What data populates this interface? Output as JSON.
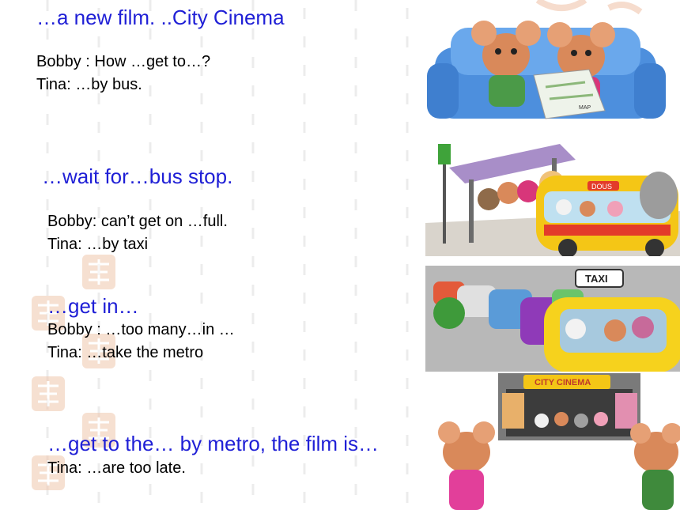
{
  "slide": {
    "scenes": [
      {
        "heading": "…a new film. ..City Cinema",
        "lines": [
          "Bobby : How …get to…?",
          "Tina:  …by bus."
        ]
      },
      {
        "heading": "…wait for…bus stop.",
        "lines": [
          "Bobby: can’t get on …full.",
          "Tina: …by taxi"
        ]
      },
      {
        "heading": "…get in…",
        "lines": [
          "Bobby : …too many…in …",
          "Tina: …take the metro"
        ]
      },
      {
        "heading": "…get to the… by metro, the film is…",
        "lines": [
          "Tina: …are too late."
        ]
      }
    ]
  },
  "illustrations": {
    "bus_sign": "DOUS",
    "taxi_sign": "TAXI",
    "cinema_sign": "CITY CINEMA",
    "map_label": "MAP"
  },
  "colors": {
    "heading": "#1f1fd6",
    "stamp": "#f0c7ad",
    "dashes": "#ececec"
  }
}
